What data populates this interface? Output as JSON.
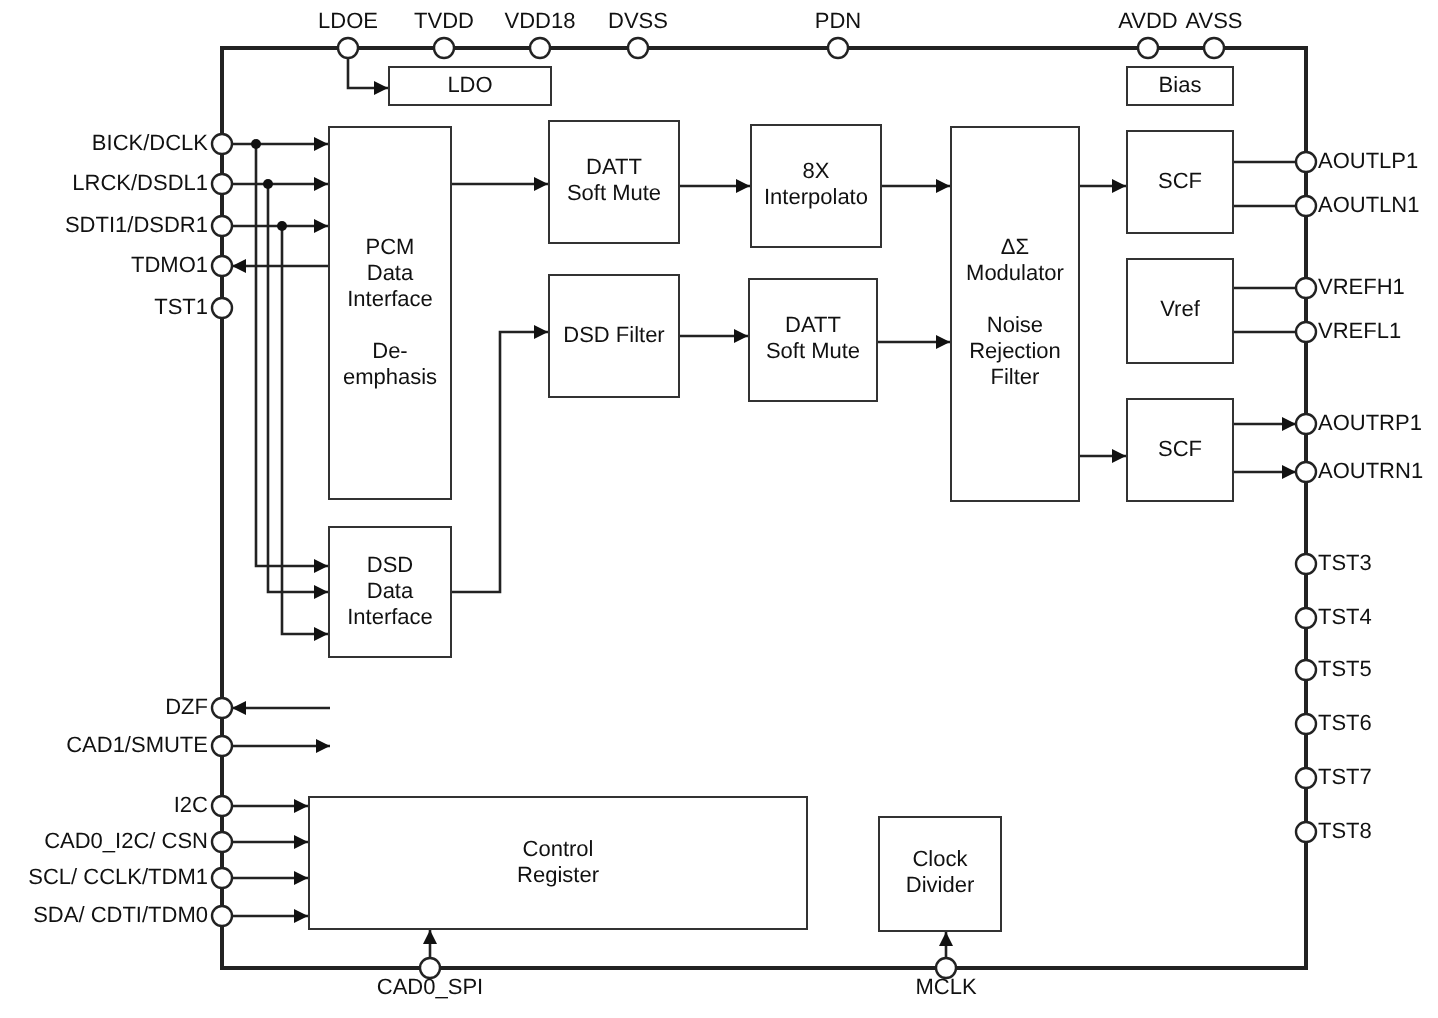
{
  "top_pins": [
    "LDOE",
    "TVDD",
    "VDD18",
    "DVSS",
    "PDN",
    "AVDD",
    "AVSS"
  ],
  "left_pins": [
    "BICK/DCLK",
    "LRCK/DSDL1",
    "SDTI1/DSDR1",
    "TDMO1",
    "TST1",
    "DZF",
    "CAD1/SMUTE",
    "I2C",
    "CAD0_I2C/ CSN",
    "SCL/ CCLK/TDM1",
    "SDA/ CDTI/TDM0"
  ],
  "right_pins": [
    "AOUTLP1",
    "AOUTLN1",
    "VREFH1",
    "VREFL1",
    "AOUTRP1",
    "AOUTRN1",
    "TST3",
    "TST4",
    "TST5",
    "TST6",
    "TST7",
    "TST8"
  ],
  "bottom_pins": [
    "CAD0_SPI",
    "MCLK"
  ],
  "blocks": [
    {
      "texts": [
        "LDO"
      ]
    },
    {
      "texts": [
        "Bias"
      ]
    },
    {
      "texts": [
        "PCM\nData\nInterface",
        "De-\nemphasis"
      ]
    },
    {
      "texts": [
        "DSD\nData\nInterface"
      ]
    },
    {
      "texts": [
        "DATT\nSoft Mute"
      ]
    },
    {
      "texts": [
        "DSD Filter"
      ]
    },
    {
      "texts": [
        "8X\nInterpolato"
      ]
    },
    {
      "texts": [
        "DATT\nSoft Mute"
      ]
    },
    {
      "texts": [
        "ΔΣ\nModulator",
        "Noise\nRejection\nFilter"
      ]
    },
    {
      "texts": [
        "SCF"
      ]
    },
    {
      "texts": [
        "Vref"
      ]
    },
    {
      "texts": [
        "SCF"
      ]
    },
    {
      "texts": [
        "Control\nRegister"
      ]
    },
    {
      "texts": [
        "Clock\nDivider"
      ]
    }
  ]
}
